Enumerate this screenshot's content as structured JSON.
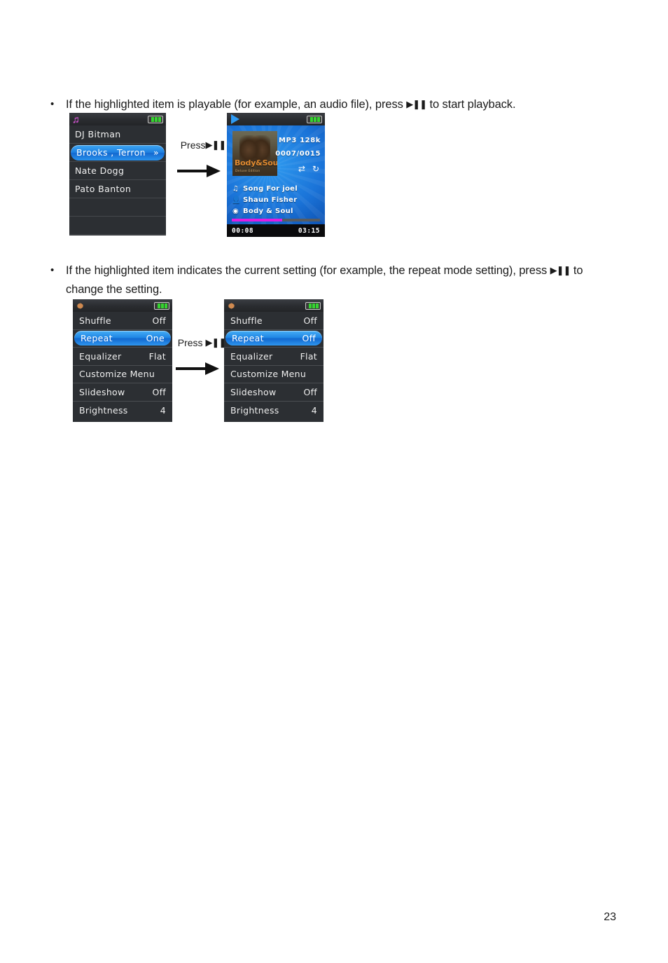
{
  "document": {
    "page_number": "23",
    "bullets": [
      {
        "marker": "•",
        "text_before": "If the highlighted item is playable (for example, an audio file), press",
        "glyph": "▶❚❚",
        "text_after": "to start playback."
      },
      {
        "marker": "•",
        "text_before": "If the highlighted item indicates the current setting (for example, the repeat mode setting), press",
        "glyph": "▶❚❚",
        "text_after": "to change the setting."
      }
    ]
  },
  "transitions": [
    {
      "label": "Press",
      "glyph": "▶❚❚",
      "arrow": "arrow-right-icon"
    },
    {
      "label": "Press",
      "glyph": "▶❚❚",
      "arrow": "arrow-right-icon"
    }
  ],
  "screen_browse": {
    "header": {
      "icon": "music-note-icon",
      "battery": "battery-full-icon"
    },
    "rows": [
      {
        "label": "DJ Bitman",
        "selected": false,
        "chevron": ""
      },
      {
        "label": "Brooks , Terron",
        "selected": true,
        "chevron": "»"
      },
      {
        "label": "Nate Dogg",
        "selected": false,
        "chevron": ""
      },
      {
        "label": "Pato Banton",
        "selected": false,
        "chevron": ""
      },
      {
        "label": "",
        "selected": false,
        "chevron": ""
      },
      {
        "label": "",
        "selected": false,
        "chevron": ""
      }
    ]
  },
  "screen_now_playing": {
    "header": {
      "icon": "play-icon",
      "battery": "battery-full-icon"
    },
    "album_art": {
      "title": "Body&Soul",
      "subtitle": "Deluxe Edition"
    },
    "format": "MP3  128k",
    "track_index": "0007/0015",
    "mode_icons": {
      "shuffle": "shuffle-icon",
      "repeat": "repeat-icon"
    },
    "lines": [
      {
        "icon": "music-note-icon",
        "text": "Song For joel"
      },
      {
        "icon": "artist-icon",
        "text": "Shaun Fisher"
      },
      {
        "icon": "album-icon",
        "text": "Body & Soul"
      }
    ],
    "elapsed": "00:08",
    "duration": "03:15",
    "progress_percent": 57,
    "progress_color": "#e21ce2"
  },
  "screen_settings_before": {
    "header": {
      "icon": "gear-icon",
      "battery": "battery-full-icon"
    },
    "rows": [
      {
        "label": "Shuffle",
        "value": "Off",
        "selected": false
      },
      {
        "label": "Repeat",
        "value": "One",
        "selected": true
      },
      {
        "label": "Equalizer",
        "value": "Flat",
        "selected": false
      },
      {
        "label": "Customize Menu",
        "value": "",
        "selected": false
      },
      {
        "label": "Slideshow",
        "value": "Off",
        "selected": false
      },
      {
        "label": "Brightness",
        "value": "4",
        "selected": false
      }
    ]
  },
  "screen_settings_after": {
    "header": {
      "icon": "gear-icon",
      "battery": "battery-full-icon"
    },
    "rows": [
      {
        "label": "Shuffle",
        "value": "Off",
        "selected": false
      },
      {
        "label": "Repeat",
        "value": "Off",
        "selected": true
      },
      {
        "label": "Equalizer",
        "value": "Flat",
        "selected": false
      },
      {
        "label": "Customize Menu",
        "value": "",
        "selected": false
      },
      {
        "label": "Slideshow",
        "value": "Off",
        "selected": false
      },
      {
        "label": "Brightness",
        "value": "4",
        "selected": false
      }
    ]
  },
  "colors": {
    "selection_blue": "#1f86e4",
    "battery_green": "#35d430",
    "note_purple": "#d24ed2",
    "gear_orange": "#d08a50",
    "progress_magenta": "#e21ce2"
  }
}
